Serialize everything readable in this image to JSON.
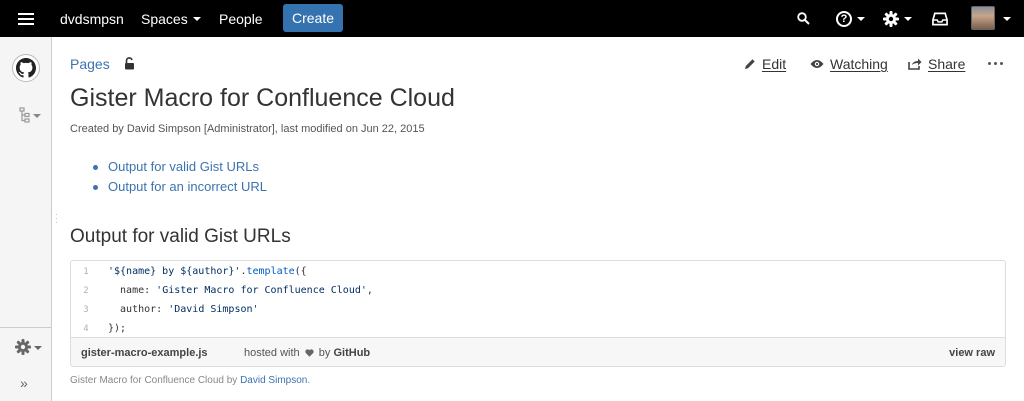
{
  "nav": {
    "site_name": "dvdsmpsn",
    "spaces_label": "Spaces",
    "people_label": "People",
    "create_label": "Create",
    "help_glyph": "?"
  },
  "icons": {
    "menu": "hamburger-icon",
    "search": "search-icon",
    "help": "help-icon",
    "settings": "gear-icon",
    "notifications": "tray-icon",
    "user": "avatar",
    "space_logo": "github-icon",
    "page_tree": "page-tree-icon",
    "lock": "lock-icon",
    "edit": "pencil-icon",
    "watch": "eye-icon",
    "share": "share-icon",
    "more": "more-icon",
    "expand_sidebar": "expand-icon",
    "heart": "heart-icon"
  },
  "colors": {
    "nav_bg": "#000000",
    "create_button": "#3572b0",
    "link": "#3b73af",
    "sidebar_bg": "#f5f5f5"
  },
  "page": {
    "breadcrumb": "Pages",
    "title": "Gister Macro for Confluence Cloud",
    "byline": "Created by David Simpson [Administrator], last modified on Jun 22, 2015",
    "actions": {
      "edit": "Edit",
      "watching": "Watching",
      "share": "Share"
    },
    "toc": [
      "Output for valid Gist URLs",
      "Output for an incorrect URL"
    ],
    "section_heading": "Output for valid Gist URLs"
  },
  "sidebar": {
    "expand_glyph": "»"
  },
  "gist": {
    "line_numbers": [
      "1",
      "2",
      "3",
      "4"
    ],
    "lines": [
      [
        {
          "t": "'${name} by ${author}'",
          "c": "str"
        },
        {
          "t": ".",
          "c": ""
        },
        {
          "t": "template",
          "c": "fn"
        },
        {
          "t": "({",
          "c": ""
        }
      ],
      [
        {
          "t": "  name: ",
          "c": ""
        },
        {
          "t": "'Gister Macro for Confluence Cloud'",
          "c": "str"
        },
        {
          "t": ",",
          "c": ""
        }
      ],
      [
        {
          "t": "  author: ",
          "c": ""
        },
        {
          "t": "'David Simpson'",
          "c": "str"
        }
      ],
      [
        {
          "t": "});",
          "c": ""
        }
      ]
    ],
    "filename": "gister-macro-example.js",
    "hosted_prefix": "hosted with",
    "hosted_suffix": "by",
    "hosted_brand": "GitHub",
    "view_raw": "view raw"
  },
  "caption": {
    "text": "Gister Macro for Confluence Cloud by",
    "author": "David Simpson",
    "end": "."
  }
}
